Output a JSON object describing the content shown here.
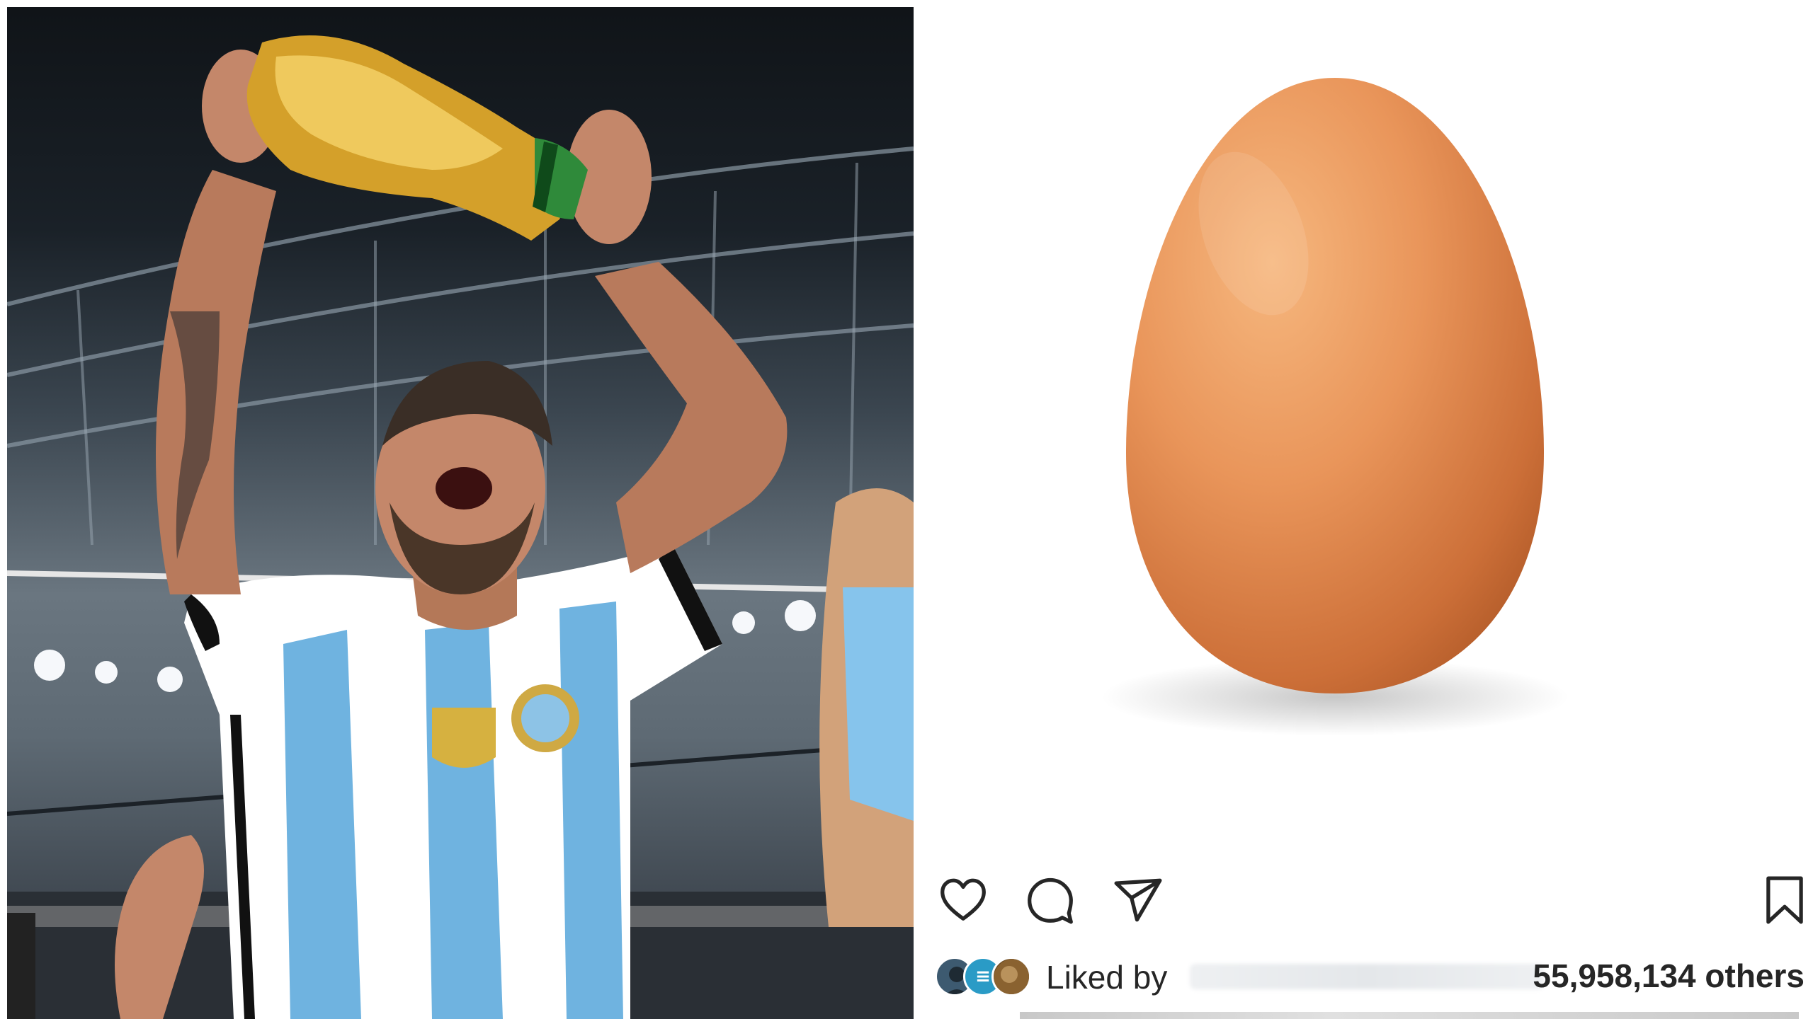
{
  "left_photo": {
    "kind": "celebration-photo"
  },
  "post": {
    "image": {
      "kind": "egg-photo"
    },
    "actions": {
      "like_icon": "heart-icon",
      "comment_icon": "comment-icon",
      "share_icon": "paper-plane-icon",
      "save_icon": "bookmark-icon"
    },
    "likes": {
      "prefix": "Liked by",
      "count_text": "55,958,134 others"
    }
  },
  "colors": {
    "egg": "#e8955a",
    "text": "#262626",
    "sky": "#101418",
    "jersey_blue": "#6fb3e0"
  }
}
